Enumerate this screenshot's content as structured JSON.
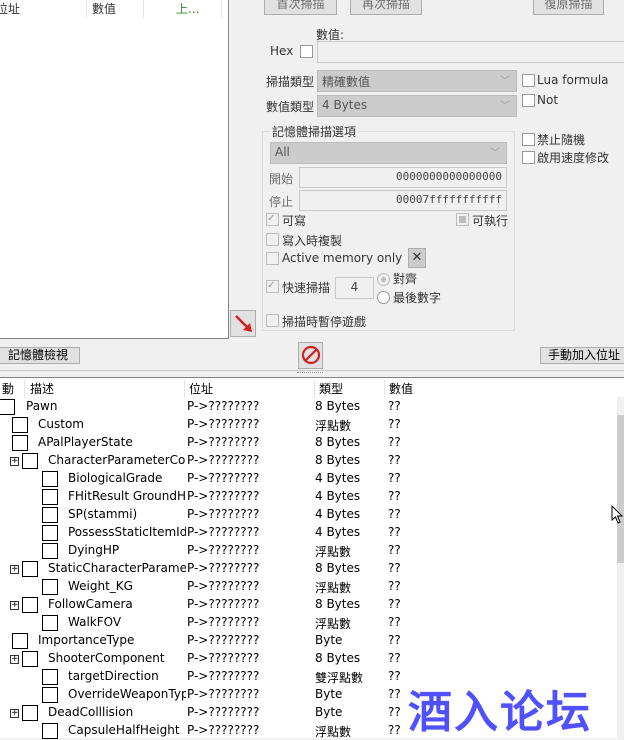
{
  "found_list": {
    "columns": [
      "位址",
      "數值",
      "上..."
    ]
  },
  "scan": {
    "first_scan": "首次掃描",
    "next_scan": "再次掃描",
    "undo_scan": "復原掃描",
    "value_label": "數值:",
    "hex_label": "Hex",
    "value": "",
    "scan_type_label": "掃描類型",
    "scan_type": "精確數值",
    "value_type_label": "數值類型",
    "value_type": "4 Bytes",
    "lua_formula": "Lua formula",
    "not": "Not",
    "no_random": "禁止隨機",
    "speedhack": "啟用速度修改"
  },
  "memory_options": {
    "title": "記憶體掃描選項",
    "region": "All",
    "start_label": "開始",
    "start": "0000000000000000",
    "stop_label": "停止",
    "stop": "00007fffffffffff",
    "writable": "可寫",
    "executable": "可執行",
    "copy_on_write": "寫入時複製",
    "active_memory": "Active memory only",
    "fast_scan": "快速掃描",
    "fast_scan_value": "4",
    "alignment": "對齊",
    "last_digits": "最後數字",
    "pause_game": "掃描時暫停遊戲"
  },
  "toolbar": {
    "memory_view": "記憶體檢視",
    "add_address": "手動加入位址"
  },
  "table": {
    "columns": [
      "動",
      "描述",
      "位址",
      "類型",
      "數值"
    ],
    "rows": [
      {
        "level": 0,
        "desc": "Pawn",
        "addr": "P->????????",
        "type": "8 Bytes",
        "val": "??"
      },
      {
        "level": 1,
        "desc": "Custom",
        "addr": "P->????????",
        "type": "浮點數",
        "val": "??"
      },
      {
        "level": 1,
        "desc": "APalPlayerState",
        "addr": "P->????????",
        "type": "8 Bytes",
        "val": "??"
      },
      {
        "level": 2,
        "expander": true,
        "desc": "CharacterParameterComponent",
        "addr": "P->????????",
        "type": "8 Bytes",
        "val": "??"
      },
      {
        "level": 3,
        "desc": "BiologicalGrade",
        "addr": "P->????????",
        "type": "4 Bytes",
        "val": "??"
      },
      {
        "level": 3,
        "desc": "FHitResult GroundHit",
        "addr": "P->????????",
        "type": "4 Bytes",
        "val": "??"
      },
      {
        "level": 3,
        "desc": "SP(stammi)",
        "addr": "P->????????",
        "type": "4 Bytes",
        "val": "??"
      },
      {
        "level": 3,
        "desc": "PossessStaticItemId",
        "addr": "P->????????",
        "type": "4 Bytes",
        "val": "??"
      },
      {
        "level": 3,
        "desc": "DyingHP",
        "addr": "P->????????",
        "type": "浮點數",
        "val": "??"
      },
      {
        "level": 2,
        "expander": true,
        "desc": "StaticCharacterParameter",
        "addr": "P->????????",
        "type": "8 Bytes",
        "val": "??"
      },
      {
        "level": 3,
        "desc": "Weight_KG",
        "addr": "P->????????",
        "type": "浮點數",
        "val": "??"
      },
      {
        "level": 2,
        "expander": true,
        "desc": "FollowCamera",
        "addr": "P->????????",
        "type": "8 Bytes",
        "val": "??"
      },
      {
        "level": 3,
        "desc": "WalkFOV",
        "addr": "P->????????",
        "type": "浮點數",
        "val": "??"
      },
      {
        "level": 1,
        "desc": "ImportanceType",
        "addr": "P->????????",
        "type": "Byte",
        "val": "??"
      },
      {
        "level": 2,
        "expander": true,
        "desc": "ShooterComponent",
        "addr": "P->????????",
        "type": "8 Bytes",
        "val": "??"
      },
      {
        "level": 3,
        "desc": "targetDirection",
        "addr": "P->????????",
        "type": "雙浮點數",
        "val": "??"
      },
      {
        "level": 3,
        "desc": "OverrideWeaponType",
        "addr": "P->????????",
        "type": "Byte",
        "val": "??"
      },
      {
        "level": 2,
        "expander": true,
        "desc": "DeadColllision",
        "addr": "P->????????",
        "type": "Byte",
        "val": "??"
      },
      {
        "level": 3,
        "desc": "CapsuleHalfHeight",
        "addr": "P->????????",
        "type": "浮點數",
        "val": "??"
      }
    ]
  },
  "watermark": "酒入论坛",
  "colors": {
    "watermark": "#5050ff",
    "accent_red": "#d42020"
  }
}
